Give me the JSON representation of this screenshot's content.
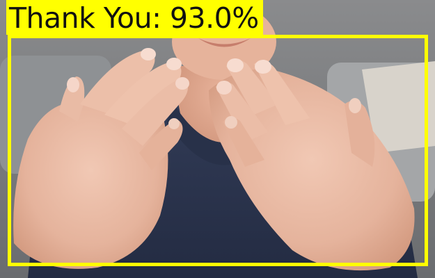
{
  "detection": {
    "label": "Thank You: 93.0%",
    "class_name": "Thank You",
    "confidence_percent": 93.0,
    "box_color": "#ffff00",
    "label_text_color": "#111111"
  },
  "scene": {
    "shirt_color": "#2b3651",
    "skin_color": "#e7b9a3",
    "background_color": "#7a7b7d",
    "sofa_color": "#8c8f92",
    "cushion_color": "#d9d4cc"
  }
}
